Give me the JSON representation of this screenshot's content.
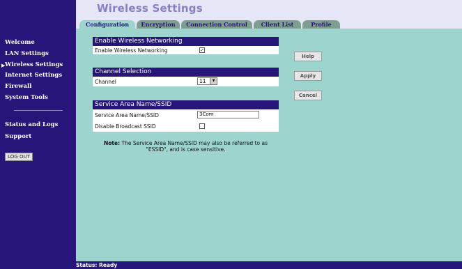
{
  "page": {
    "title": "Wireless Settings"
  },
  "tabs": [
    {
      "label": "Configuration",
      "active": true
    },
    {
      "label": "Encryption",
      "active": false
    },
    {
      "label": "Connection Control",
      "active": false
    },
    {
      "label": "Client List",
      "active": false
    },
    {
      "label": "Profile",
      "active": false
    }
  ],
  "sidebar": {
    "items": [
      {
        "label": "Welcome"
      },
      {
        "label": "LAN Settings"
      },
      {
        "label": "Wireless Settings",
        "selected": true
      },
      {
        "label": "Internet Settings"
      },
      {
        "label": "Firewall"
      },
      {
        "label": "System Tools"
      },
      {
        "label": "Status and Logs"
      },
      {
        "label": "Support"
      }
    ],
    "selected_marker": "▶",
    "logout_label": "LOG OUT"
  },
  "sections": {
    "wireless": {
      "header": "Enable Wireless Networking",
      "enable_label": "Enable Wireless Networking",
      "enable_checked": true
    },
    "channel": {
      "header": "Channel Selection",
      "channel_label": "Channel",
      "channel_value": "11"
    },
    "ssid": {
      "header": "Service Area Name/SSID",
      "ssid_label": "Service Area Name/SSID",
      "ssid_value": "3Com",
      "disable_broadcast_label": "Disable Broadcast SSID",
      "disable_broadcast_checked": false
    }
  },
  "buttons": {
    "help": "Help",
    "apply": "Apply",
    "cancel": "Cancel"
  },
  "note": {
    "prefix": "Note:",
    "text": "The Service Area Name/SSID may also be referred to as \"ESSID\", and is case sensitive."
  },
  "status": {
    "text": "Status: Ready"
  },
  "icons": {
    "checkmark": "✓",
    "dropdown": "▼"
  },
  "colors": {
    "nav_bg": "#27157a",
    "content_bg": "#9dd4ce",
    "title": "#8880c6",
    "tab_inactive": "#7e9f8f"
  }
}
